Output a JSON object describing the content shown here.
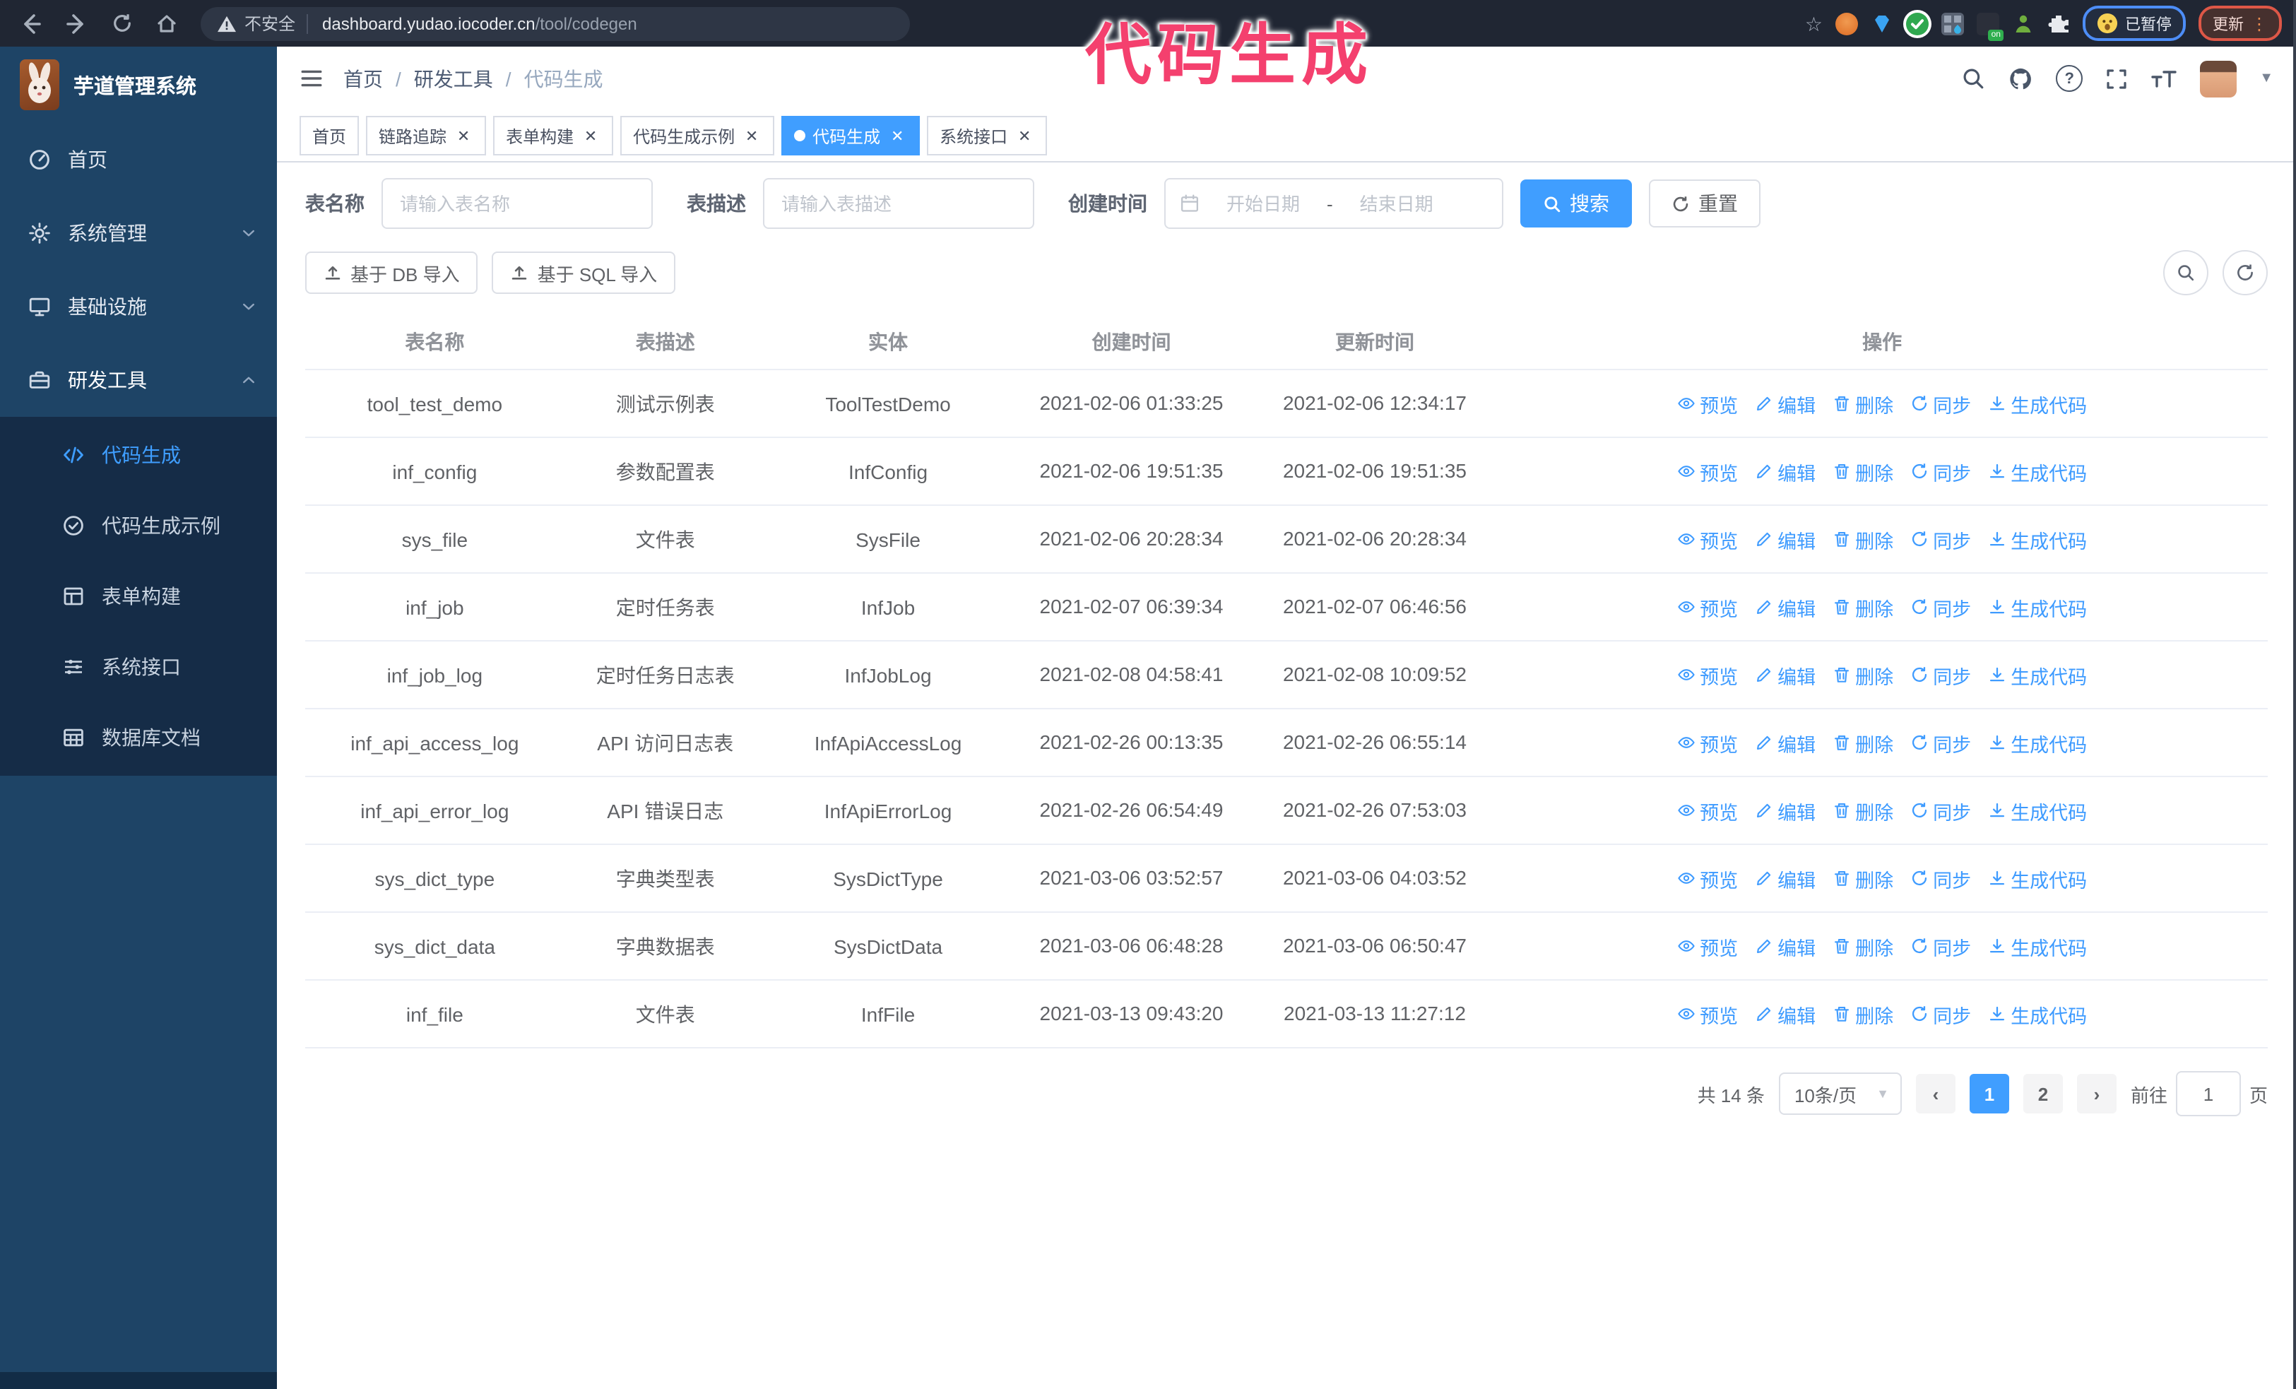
{
  "browser": {
    "security_label": "不安全",
    "url_host": "dashboard.yudao.iocoder.cn",
    "url_path": "/tool/codegen",
    "paused_badge": "已暂停",
    "update_label": "更新"
  },
  "annotation": {
    "text": "代码生成",
    "color": "#f4406e"
  },
  "sidebar": {
    "logo_title": "芋道管理系统",
    "items": [
      {
        "label": "首页"
      },
      {
        "label": "系统管理"
      },
      {
        "label": "基础设施"
      },
      {
        "label": "研发工具"
      }
    ],
    "submenu": [
      {
        "label": "代码生成",
        "active": true
      },
      {
        "label": "代码生成示例"
      },
      {
        "label": "表单构建"
      },
      {
        "label": "系统接口"
      },
      {
        "label": "数据库文档"
      }
    ]
  },
  "header": {
    "breadcrumb": [
      "首页",
      "研发工具",
      "代码生成"
    ],
    "tabs": [
      {
        "label": "首页"
      },
      {
        "label": "链路追踪"
      },
      {
        "label": "表单构建"
      },
      {
        "label": "代码生成示例"
      },
      {
        "label": "代码生成",
        "active": true
      },
      {
        "label": "系统接口"
      }
    ]
  },
  "search": {
    "name_label": "表名称",
    "name_placeholder": "请输入表名称",
    "desc_label": "表描述",
    "desc_placeholder": "请输入表描述",
    "time_label": "创建时间",
    "start_placeholder": "开始日期",
    "range_separator": "-",
    "end_placeholder": "结束日期",
    "search_label": "搜索",
    "reset_label": "重置"
  },
  "toolbar": {
    "db_import_label": "基于 DB 导入",
    "sql_import_label": "基于 SQL 导入"
  },
  "table": {
    "columns": [
      "表名称",
      "表描述",
      "实体",
      "创建时间",
      "更新时间",
      "操作"
    ],
    "actions": [
      "预览",
      "编辑",
      "删除",
      "同步",
      "生成代码"
    ],
    "rows": [
      {
        "name": "tool_test_demo",
        "desc": "测试示例表",
        "entity": "ToolTestDemo",
        "created": "2021-02-06 01:33:25",
        "updated": "2021-02-06 12:34:17"
      },
      {
        "name": "inf_config",
        "desc": "参数配置表",
        "entity": "InfConfig",
        "created": "2021-02-06 19:51:35",
        "updated": "2021-02-06 19:51:35"
      },
      {
        "name": "sys_file",
        "desc": "文件表",
        "entity": "SysFile",
        "created": "2021-02-06 20:28:34",
        "updated": "2021-02-06 20:28:34"
      },
      {
        "name": "inf_job",
        "desc": "定时任务表",
        "entity": "InfJob",
        "created": "2021-02-07 06:39:34",
        "updated": "2021-02-07 06:46:56"
      },
      {
        "name": "inf_job_log",
        "desc": "定时任务日志表",
        "entity": "InfJobLog",
        "created": "2021-02-08 04:58:41",
        "updated": "2021-02-08 10:09:52"
      },
      {
        "name": "inf_api_access_log",
        "desc": "API 访问日志表",
        "entity": "InfApiAccessLog",
        "created": "2021-02-26 00:13:35",
        "updated": "2021-02-26 06:55:14"
      },
      {
        "name": "inf_api_error_log",
        "desc": "API 错误日志",
        "entity": "InfApiErrorLog",
        "created": "2021-02-26 06:54:49",
        "updated": "2021-02-26 07:53:03"
      },
      {
        "name": "sys_dict_type",
        "desc": "字典类型表",
        "entity": "SysDictType",
        "created": "2021-03-06 03:52:57",
        "updated": "2021-03-06 04:03:52"
      },
      {
        "name": "sys_dict_data",
        "desc": "字典数据表",
        "entity": "SysDictData",
        "created": "2021-03-06 06:48:28",
        "updated": "2021-03-06 06:50:47"
      },
      {
        "name": "inf_file",
        "desc": "文件表",
        "entity": "InfFile",
        "created": "2021-03-13 09:43:20",
        "updated": "2021-03-13 11:27:12"
      }
    ]
  },
  "pagination": {
    "total_label": "共 14 条",
    "page_size_label": "10条/页",
    "pages": [
      "1",
      "2"
    ],
    "active_page": "1",
    "goto_label": "前往",
    "goto_value": "1",
    "page_unit_label": "页"
  }
}
